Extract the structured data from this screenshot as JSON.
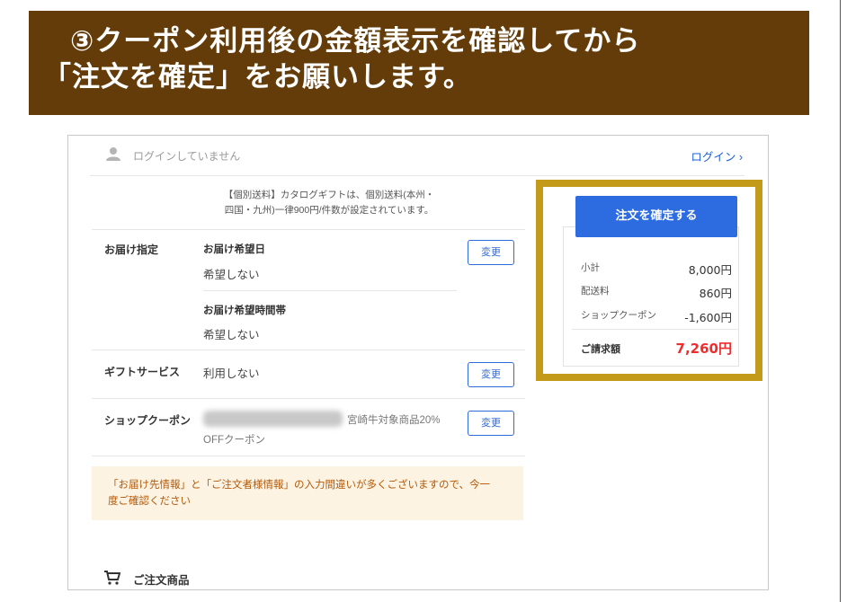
{
  "banner": {
    "line1": "③クーポン利用後の金額表示を確認してから",
    "line2": "「注文を確定」をお願いします。"
  },
  "header": {
    "login_status": "ログインしていません",
    "login_link": "ログイン"
  },
  "notice": {
    "line1": "【個別送料】カタログギフトは、個別送料(本州・",
    "line2": "四国・九州)一律900円/件数が設定されています。"
  },
  "delivery": {
    "label": "お届け指定",
    "date_heading": "お届け希望日",
    "date_value": "希望しない",
    "time_heading": "お届け希望時間帯",
    "time_value": "希望しない",
    "change_label": "変更"
  },
  "gift": {
    "label": "ギフトサービス",
    "value": "利用しない",
    "change_label": "変更"
  },
  "coupon": {
    "label": "ショップクーポン",
    "value_line1": "宮崎牛対象商品20%",
    "value_line2": "OFFクーポン",
    "change_label": "変更"
  },
  "warning": {
    "line1": "「お届け先情報」と「ご注文者様情報」の入力間違いが多くございますので、今一",
    "line2": "度ご確認ください"
  },
  "cart": {
    "title": "ご注文商品"
  },
  "summary": {
    "confirm_label": "注文を確定する",
    "rows": [
      {
        "label": "小計",
        "value": "8,000円"
      },
      {
        "label": "配送料",
        "value": "860円"
      },
      {
        "label": "ショップクーポン",
        "value": "-1,600円"
      }
    ],
    "total_label": "ご請求額",
    "total_value": "7,260円"
  },
  "colors": {
    "banner_bg": "#643c0a",
    "highlight_border": "#c49a1b",
    "primary_button": "#2d6be0",
    "total_red": "#ef2d2d",
    "warning_bg": "#fdf3e3",
    "warning_text": "#b35a0a"
  },
  "icons": [
    "user-icon",
    "chevron-right-icon",
    "cart-icon"
  ]
}
